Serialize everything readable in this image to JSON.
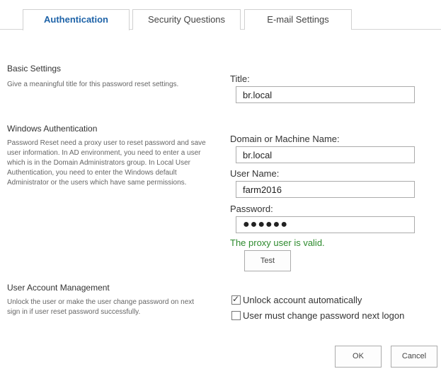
{
  "tabs": [
    {
      "label": "Authentication",
      "active": true
    },
    {
      "label": "Security Questions",
      "active": false
    },
    {
      "label": "E-mail Settings",
      "active": false
    }
  ],
  "basic_settings": {
    "title": "Basic Settings",
    "description": "Give a meaningful title for this password reset settings.",
    "title_label": "Title:",
    "title_value": "br.local"
  },
  "windows_auth": {
    "title": "Windows Authentication",
    "description": "Password Reset need a proxy user to reset password and save user information. In AD environment, you need to enter a user which is in the Domain Administrators group. In Local User Authentication, you need to enter the Windows default Administrator or the users which have same permissions.",
    "domain_label": "Domain or Machine Name:",
    "domain_value": "br.local",
    "user_label": "User Name:",
    "user_value": "farm2016",
    "password_label": "Password:",
    "password_value": "●●●●●●",
    "valid_message": "The proxy user is valid.",
    "test_button": "Test"
  },
  "account_mgmt": {
    "title": "User Account Management",
    "description": "Unlock the user or make the user change password on next sign in if user reset password successfully.",
    "unlock_label": "Unlock account automatically",
    "unlock_checked": true,
    "change_pwd_label": "User must change password next logon",
    "change_pwd_checked": false
  },
  "footer": {
    "ok_label": "OK",
    "cancel_label": "Cancel"
  },
  "colors": {
    "active_tab": "#1e63a8",
    "valid_text": "#2d8a2d"
  }
}
